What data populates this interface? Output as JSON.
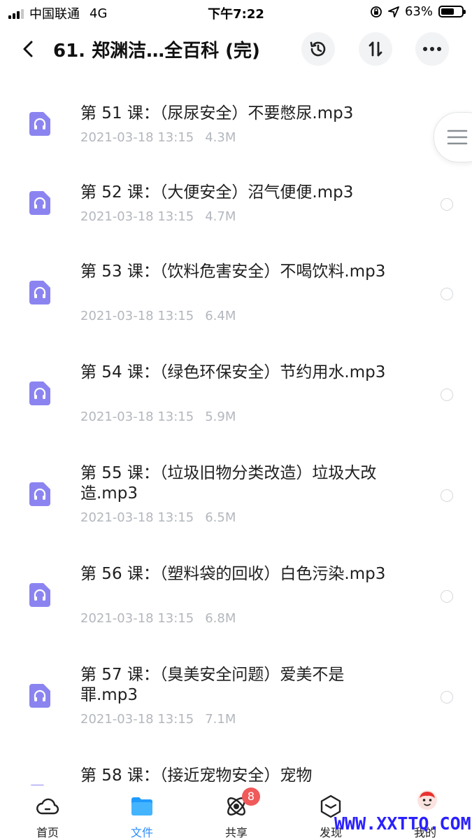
{
  "status_bar": {
    "carrier": "中国联通",
    "network": "4G",
    "time": "下午7:22",
    "battery": "63%",
    "battery_level": 0.63
  },
  "header": {
    "title": "61. 郑渊洁…全百科 (完)",
    "icons": [
      "back-icon",
      "history-icon",
      "sort-icon",
      "more-icon"
    ]
  },
  "files": [
    {
      "name": "第 51 课：（尿尿安全）不要憋尿.mp3",
      "date": "2021-03-18 13:15",
      "size": "4.3M"
    },
    {
      "name": "第 52 课：（大便安全）沼气便便.mp3",
      "date": "2021-03-18 13:15",
      "size": "4.7M"
    },
    {
      "name": "第 53 课：（饮料危害安全）不喝饮料.mp3",
      "date": "2021-03-18 13:15",
      "size": "6.4M"
    },
    {
      "name": "第 54 课：（绿色环保安全）节约用水.mp3",
      "date": "2021-03-18 13:15",
      "size": "5.9M"
    },
    {
      "name": "第 55 课：（垃圾旧物分类改造）垃圾大改造.mp3",
      "date": "2021-03-18 13:15",
      "size": "6.5M"
    },
    {
      "name": "第 56 课：（塑料袋的回收）白色污染.mp3",
      "date": "2021-03-18 13:15",
      "size": "6.8M"
    },
    {
      "name": "第 57 课：（臭美安全问题）爱美不是罪.mp3",
      "date": "2021-03-18 13:15",
      "size": "7.1M"
    },
    {
      "name": "第 58 课：（接近宠物安全）宠物"
    }
  ],
  "tabs": [
    {
      "label": "首页",
      "icon": "cloud-icon"
    },
    {
      "label": "文件",
      "icon": "folder-icon",
      "active": true
    },
    {
      "label": "共享",
      "icon": "share-orbit-icon",
      "badge": "8"
    },
    {
      "label": "发现",
      "icon": "discover-box-icon"
    },
    {
      "label": "我的",
      "icon": "profile-avatar-icon"
    }
  ],
  "watermark": "WWW.XXTTQ.COM",
  "colors": {
    "accent": "#2a8cff",
    "file_icon": "#8b84f0",
    "badge": "#f05a5a",
    "meta_text": "#b3b7bd",
    "watermark": "#2a20ff"
  }
}
